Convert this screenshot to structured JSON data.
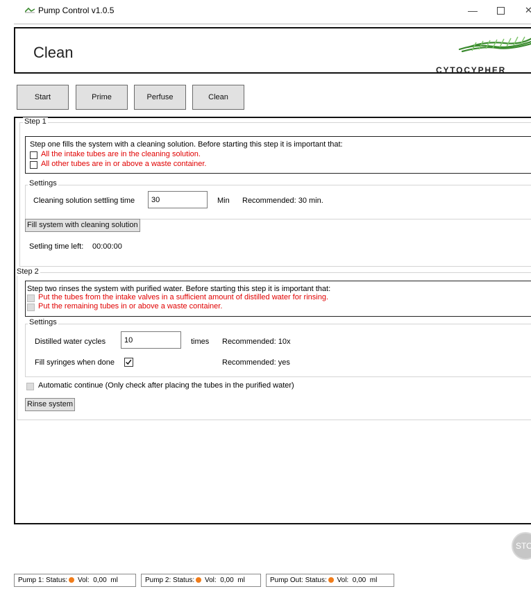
{
  "window": {
    "title": "Pump Control v1.0.5",
    "minimize_label": "—",
    "close_label": "✕"
  },
  "header": {
    "page_title": "Clean",
    "logo_text": "CYTOCYPHER"
  },
  "nav": {
    "start": "Start",
    "prime": "Prime",
    "perfuse": "Perfuse",
    "clean": "Clean"
  },
  "step1": {
    "title": "Step 1",
    "intro": "Step one fills the system with a cleaning solution. Before starting this step it is important that:",
    "checks": [
      {
        "label": "All the intake tubes are in the cleaning solution.",
        "checked": false
      },
      {
        "label": "All other tubes are in or above a waste container.",
        "checked": false
      }
    ],
    "settings_title": "Settings",
    "settling_label": "Cleaning solution settling time",
    "settling_value": "30",
    "settling_unit": "Min",
    "settling_recommended": "Recommended: 30 min.",
    "fill_button": "Fill system with cleaning solution",
    "time_left_label": "Setling time left:",
    "time_left_value": "00:00:00"
  },
  "step2": {
    "title": "Step 2",
    "intro": "Step two rinses the system with purified water. Before starting this step it is important that:",
    "checks": [
      {
        "label": "Put the tubes from the intake valves in a sufficient amount of distilled water for rinsing.",
        "checked": false
      },
      {
        "label": "Put the remaining tubes in or above a waste container.",
        "checked": false
      }
    ],
    "settings_title": "Settings",
    "cycles_label": "Distilled water cycles",
    "cycles_value": "10",
    "cycles_unit": "times",
    "cycles_recommended": "Recommended: 10x",
    "fill_syringes_label": "Fill syringes when done",
    "fill_syringes_checked": true,
    "fill_syringes_recommended": "Recommended: yes",
    "auto_continue_label": "Automatic continue (Only check after placing the tubes in the purified water)",
    "rinse_button": "Rinse system"
  },
  "stop_label": "STOP",
  "status_bar": [
    {
      "name": "Pump 1:",
      "status_label": "Status:",
      "status_color": "#f07c1a",
      "vol_label": "Vol:",
      "vol_value": "0,00",
      "unit": "ml"
    },
    {
      "name": "Pump 2:",
      "status_label": "Status:",
      "status_color": "#f07c1a",
      "vol_label": "Vol:",
      "vol_value": "0,00",
      "unit": "ml"
    },
    {
      "name": "Pump Out:",
      "status_label": "Status:",
      "status_color": "#f07c1a",
      "vol_label": "Vol:",
      "vol_value": "0,00",
      "unit": "ml"
    }
  ],
  "colors": {
    "warning_text": "#e00000",
    "status_idle": "#f07c1a",
    "logo_green": "#3a8a2e"
  }
}
